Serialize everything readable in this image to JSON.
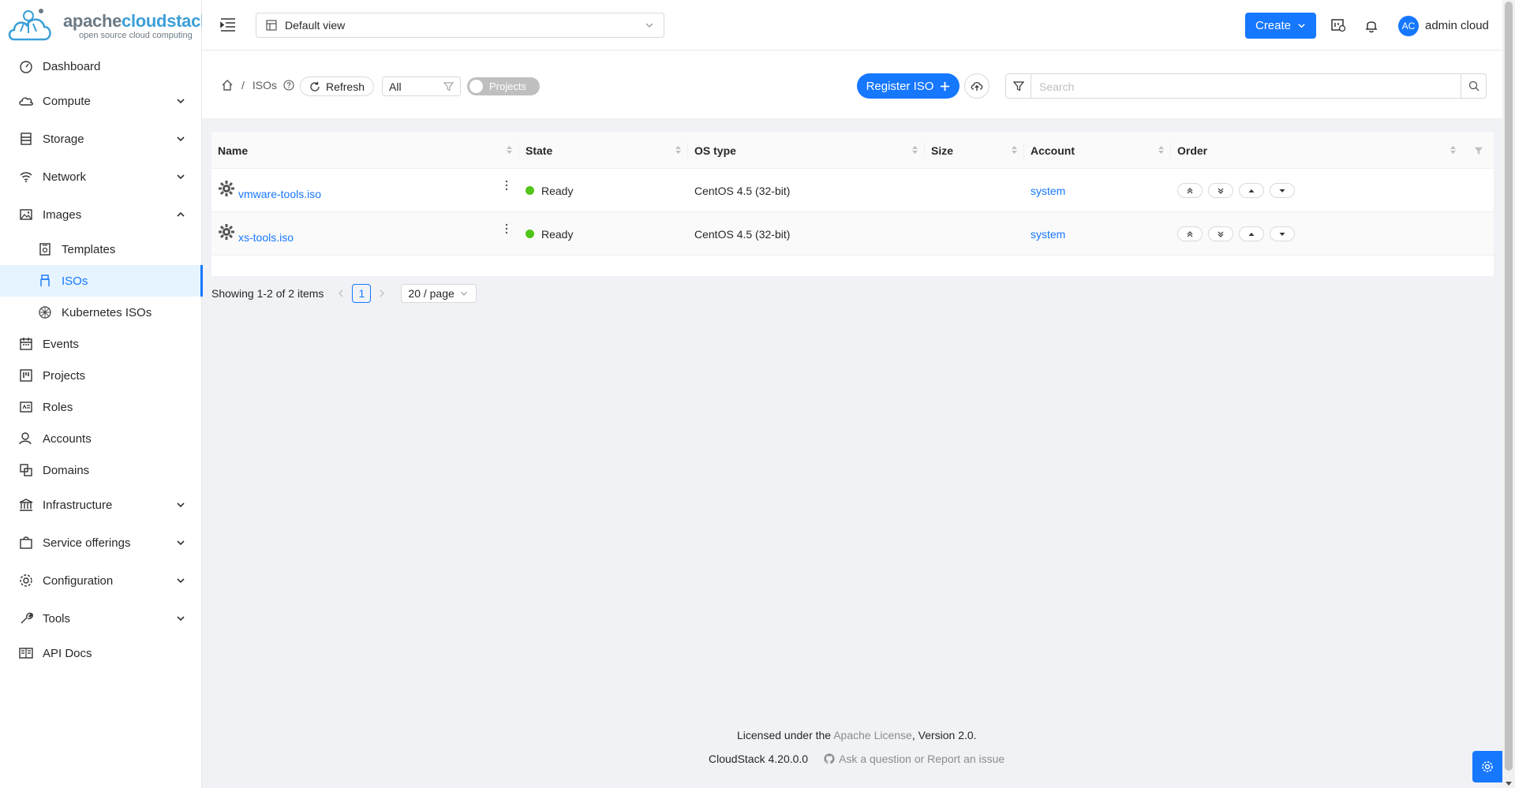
{
  "brand": {
    "name_a": "apache",
    "name_b": "cloudstack",
    "tagline": "open source cloud computing"
  },
  "sidebar": {
    "items": [
      {
        "label": "Dashboard"
      },
      {
        "label": "Compute"
      },
      {
        "label": "Storage"
      },
      {
        "label": "Network"
      },
      {
        "label": "Images"
      },
      {
        "label": "Templates"
      },
      {
        "label": "ISOs"
      },
      {
        "label": "Kubernetes ISOs"
      },
      {
        "label": "Events"
      },
      {
        "label": "Projects"
      },
      {
        "label": "Roles"
      },
      {
        "label": "Accounts"
      },
      {
        "label": "Domains"
      },
      {
        "label": "Infrastructure"
      },
      {
        "label": "Service offerings"
      },
      {
        "label": "Configuration"
      },
      {
        "label": "Tools"
      },
      {
        "label": "API Docs"
      }
    ]
  },
  "header": {
    "view_select": "Default view",
    "create_label": "Create",
    "avatar_initials": "AC",
    "username": "admin cloud"
  },
  "toolbar": {
    "breadcrumb_current": "ISOs",
    "refresh_label": "Refresh",
    "filter_value": "All",
    "projects_label": "Projects",
    "register_label": "Register ISO",
    "search_placeholder": "Search"
  },
  "table": {
    "columns": [
      "Name",
      "State",
      "OS type",
      "Size",
      "Account",
      "Order"
    ],
    "rows": [
      {
        "name": "vmware-tools.iso",
        "state": "Ready",
        "os_type": "CentOS 4.5 (32-bit)",
        "size": "",
        "account": "system"
      },
      {
        "name": "xs-tools.iso",
        "state": "Ready",
        "os_type": "CentOS 4.5 (32-bit)",
        "size": "",
        "account": "system"
      }
    ]
  },
  "pagination": {
    "summary": "Showing 1-2 of 2 items",
    "current_page": "1",
    "page_size": "20 / page"
  },
  "footer": {
    "license_prefix": "Licensed under the ",
    "license_link": "Apache License",
    "license_suffix": ", Version 2.0.",
    "version": "CloudStack 4.20.0.0",
    "report": "Ask a question or Report an issue"
  },
  "colors": {
    "primary": "#1677ff",
    "ready": "#52c41a",
    "active_bg": "#e6f4ff"
  }
}
